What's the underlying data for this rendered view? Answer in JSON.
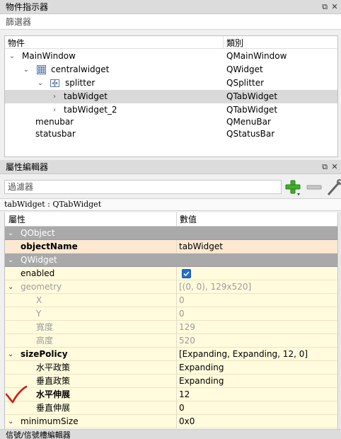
{
  "object_inspector": {
    "title": "物件指示器",
    "filter_placeholder": "篩選器",
    "columns": {
      "object": "物件",
      "class": "類別"
    },
    "rows": [
      {
        "object": "MainWindow",
        "class": "QMainWindow",
        "arrow": "⌄",
        "icon": ""
      },
      {
        "object": "centralwidget",
        "class": "QWidget",
        "arrow": "⌄",
        "icon": "grid-layout-icon"
      },
      {
        "object": "splitter",
        "class": "QSplitter",
        "arrow": "⌄",
        "icon": "splitter-icon"
      },
      {
        "object": "tabWidget",
        "class": "QTabWidget",
        "arrow": "›",
        "icon": "",
        "selected": true
      },
      {
        "object": "tabWidget_2",
        "class": "QTabWidget",
        "arrow": "›",
        "icon": ""
      },
      {
        "object": "menubar",
        "class": "QMenuBar",
        "arrow": "",
        "icon": ""
      },
      {
        "object": "statusbar",
        "class": "QStatusBar",
        "arrow": "",
        "icon": ""
      }
    ]
  },
  "property_editor": {
    "title": "屬性編輯器",
    "filter_placeholder": "過濾器",
    "class_label": "tabWidget : QTabWidget",
    "columns": {
      "property": "屬性",
      "value": "數值"
    },
    "rows": [
      {
        "kind": "group",
        "name": "QObject",
        "value": ""
      },
      {
        "kind": "prop",
        "name": "objectName",
        "value": "tabWidget",
        "bold": true,
        "bg": "peach"
      },
      {
        "kind": "group",
        "name": "QWidget",
        "value": ""
      },
      {
        "kind": "prop",
        "name": "enabled",
        "value": "",
        "checkbox": true
      },
      {
        "kind": "prop",
        "name": "geometry",
        "value": "[(0, 0), 129x520]",
        "dim": true,
        "expander": "⌄"
      },
      {
        "kind": "sub",
        "name": "X",
        "value": "0",
        "dim": true
      },
      {
        "kind": "sub",
        "name": "Y",
        "value": "0",
        "dim": true
      },
      {
        "kind": "sub",
        "name": "寬度",
        "value": "129",
        "dim": true
      },
      {
        "kind": "sub",
        "name": "高度",
        "value": "520",
        "dim": true
      },
      {
        "kind": "prop",
        "name": "sizePolicy",
        "value": "[Expanding, Expanding, 12, 0]",
        "bold": true,
        "expander": "⌄"
      },
      {
        "kind": "sub",
        "name": "水平政策",
        "value": "Expanding"
      },
      {
        "kind": "sub",
        "name": "垂直政策",
        "value": "Expanding"
      },
      {
        "kind": "sub",
        "name": "水平伸展",
        "value": "12",
        "bold": true
      },
      {
        "kind": "sub",
        "name": "垂直伸展",
        "value": "0"
      },
      {
        "kind": "prop",
        "name": "minimumSize",
        "value": "0x0",
        "expander": "⌄"
      }
    ]
  },
  "bottom_dock": {
    "title": "信號/信號槽編輯器"
  },
  "colors": {
    "group_bg": "#a9a9a9",
    "row_bg": "#fffbdc",
    "selected_bg": "#fde8d2",
    "checkbox": "#1f6fd6",
    "mark": "#d21a1a"
  }
}
